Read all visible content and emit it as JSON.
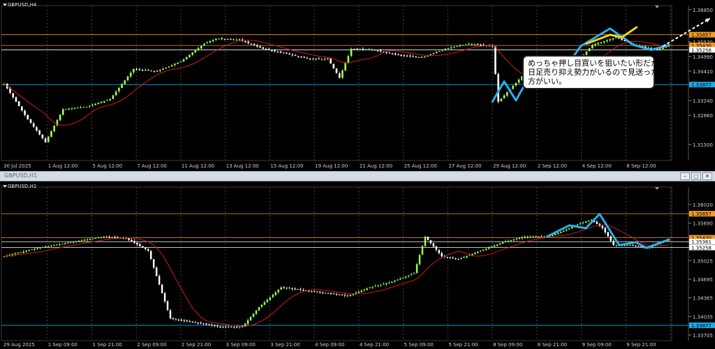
{
  "window": {
    "subwindow_title": "GBPUSD,H1",
    "buttons": [
      "–",
      "▢",
      "✕"
    ]
  },
  "annotation": {
    "lines": [
      "めっちゃ押し目買いを狙いたい形だが、",
      "日足売り抑え勢力がいるので見送った",
      "方がいい。"
    ]
  },
  "chart_data": [
    {
      "type": "candlestick",
      "title": "GBPUSD,H4",
      "bull_color": "#9cff57",
      "bear_color": "#ffffff",
      "ma_color": "#d11a1a",
      "grid": true,
      "ylim": [
        1.3092,
        1.369
      ],
      "y_ticks": [
        "1.36850",
        "1.35570",
        "1.34990",
        "1.34410",
        "1.33240",
        "1.32660",
        "1.31500"
      ],
      "x_ticks": [
        "30 Jul 2025",
        "1 Aug 12:00",
        "5 Aug 12:00",
        "7 Aug 12:00",
        "11 Aug 12:00",
        "13 Aug 12:00",
        "15 Aug 12:00",
        "19 Aug 12:00",
        "21 Aug 12:00",
        "25 Aug 12:00",
        "27 Aug 12:00",
        "29 Aug 12:00",
        "2 Sep 12:00",
        "4 Sep 12:00",
        "8 Sep 12:00"
      ],
      "levels": [
        {
          "value": 1.35857,
          "label": "1.35857",
          "color": "#f29b24"
        },
        {
          "value": 1.3543,
          "label": "1.35430",
          "color": "#f29b24"
        },
        {
          "value": 1.35258,
          "label": "1.35258",
          "color": "#ffffff"
        },
        {
          "value": 1.33877,
          "label": "1.33877",
          "color": "#1fa9e8"
        }
      ],
      "close_anchors": [
        [
          0,
          1.339
        ],
        [
          8,
          1.325
        ],
        [
          14,
          1.316
        ],
        [
          20,
          1.329
        ],
        [
          28,
          1.33
        ],
        [
          36,
          1.333
        ],
        [
          44,
          1.345
        ],
        [
          52,
          1.344
        ],
        [
          60,
          1.348
        ],
        [
          68,
          1.355
        ],
        [
          72,
          1.357
        ],
        [
          80,
          1.3565
        ],
        [
          88,
          1.353
        ],
        [
          96,
          1.351
        ],
        [
          104,
          1.349
        ],
        [
          110,
          1.349
        ],
        [
          114,
          1.3415
        ],
        [
          118,
          1.353
        ],
        [
          126,
          1.3525
        ],
        [
          134,
          1.3505
        ],
        [
          142,
          1.3495
        ],
        [
          150,
          1.353
        ],
        [
          158,
          1.355
        ],
        [
          166,
          1.354
        ],
        [
          168,
          1.332
        ],
        [
          176,
          1.342
        ],
        [
          184,
          1.3435
        ],
        [
          192,
          1.344
        ],
        [
          200,
          1.3545
        ],
        [
          208,
          1.3575
        ],
        [
          214,
          1.3545
        ],
        [
          222,
          1.3525
        ],
        [
          226,
          1.3545
        ]
      ],
      "overlay_cyan": [
        [
          166,
          1.332
        ],
        [
          170,
          1.34
        ],
        [
          174,
          1.3325
        ],
        [
          180,
          1.345
        ],
        [
          186,
          1.343
        ],
        [
          190,
          1.344
        ],
        [
          196,
          1.354
        ],
        [
          206,
          1.361
        ],
        [
          214,
          1.3545
        ],
        [
          220,
          1.3525
        ],
        [
          226,
          1.3545
        ]
      ],
      "overlay_yellow": [
        [
          198,
          1.355
        ],
        [
          206,
          1.3585
        ],
        [
          210,
          1.3575
        ],
        [
          215,
          1.3615
        ]
      ],
      "forecast_arrow": [
        [
          224,
          1.354
        ],
        [
          240,
          1.365
        ]
      ]
    },
    {
      "type": "candlestick",
      "title": "GBPUSD,H1",
      "bull_color": "#9cff57",
      "bear_color": "#ffffff",
      "ma_color": "#d11a1a",
      "grid": true,
      "ylim": [
        1.3363,
        1.3628
      ],
      "y_ticks": [
        "1.36020",
        "1.35857",
        "1.35690",
        "1.35361",
        "1.35258",
        "1.35025",
        "1.34695",
        "1.34365",
        "1.34035",
        "1.33877",
        "1.33705"
      ],
      "x_ticks": [
        "29 Aug 2025",
        "1 Sep 09:00",
        "1 Sep 21:00",
        "2 Sep 09:00",
        "2 Sep 21:00",
        "3 Sep 09:00",
        "3 Sep 21:00",
        "4 Sep 09:00",
        "4 Sep 21:00",
        "5 Sep 09:00",
        "5 Sep 21:00",
        "8 Sep 09:00",
        "8 Sep 21:00",
        "9 Sep 09:00",
        "9 Sep 21:00"
      ],
      "levels": [
        {
          "value": 1.35857,
          "label": "1.35857",
          "color": "#f29b24"
        },
        {
          "value": 1.3543,
          "label": "1.35430",
          "color": "#f29b24"
        },
        {
          "value": 1.35361,
          "label": "1.35361",
          "color": "#ffffff"
        },
        {
          "value": 1.35258,
          "label": "1.35258",
          "color": "#ffffff"
        },
        {
          "value": 1.33877,
          "label": "1.33877",
          "color": "#1fa9e8"
        }
      ],
      "close_anchors": [
        [
          0,
          1.351
        ],
        [
          12,
          1.3525
        ],
        [
          24,
          1.3535
        ],
        [
          36,
          1.3545
        ],
        [
          44,
          1.3542
        ],
        [
          52,
          1.352
        ],
        [
          56,
          1.346
        ],
        [
          60,
          1.34
        ],
        [
          66,
          1.3395
        ],
        [
          72,
          1.339
        ],
        [
          78,
          1.3385
        ],
        [
          86,
          1.3385
        ],
        [
          92,
          1.342
        ],
        [
          100,
          1.3455
        ],
        [
          108,
          1.345
        ],
        [
          116,
          1.3445
        ],
        [
          124,
          1.344
        ],
        [
          132,
          1.3455
        ],
        [
          140,
          1.3465
        ],
        [
          148,
          1.348
        ],
        [
          152,
          1.3545
        ],
        [
          158,
          1.351
        ],
        [
          164,
          1.3505
        ],
        [
          172,
          1.352
        ],
        [
          180,
          1.3535
        ],
        [
          188,
          1.3545
        ],
        [
          196,
          1.3545
        ],
        [
          202,
          1.3555
        ],
        [
          206,
          1.3565
        ],
        [
          212,
          1.3575
        ],
        [
          216,
          1.356
        ],
        [
          220,
          1.353
        ],
        [
          226,
          1.353
        ],
        [
          232,
          1.3525
        ],
        [
          240,
          1.354
        ]
      ],
      "overlay_cyan": [
        [
          196,
          1.3545
        ],
        [
          204,
          1.3565
        ],
        [
          210,
          1.356
        ],
        [
          215,
          1.3585
        ],
        [
          222,
          1.353
        ],
        [
          228,
          1.3535
        ],
        [
          232,
          1.3525
        ],
        [
          240,
          1.354
        ]
      ]
    }
  ]
}
